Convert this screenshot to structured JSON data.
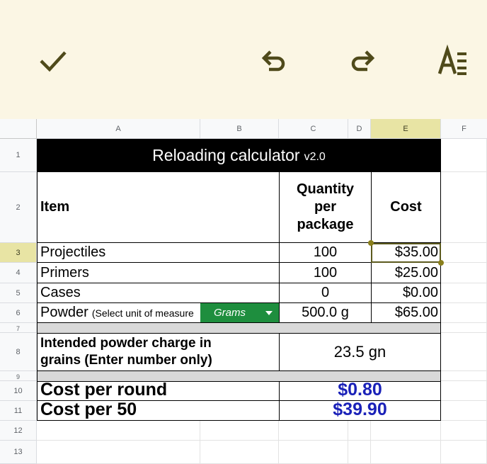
{
  "toolbar": {
    "confirm_icon": "check-icon",
    "undo_icon": "undo-icon",
    "redo_icon": "redo-icon",
    "format_icon": "text-format-icon"
  },
  "columns": [
    "A",
    "B",
    "C",
    "D",
    "E",
    "F"
  ],
  "rows": [
    "1",
    "2",
    "3",
    "4",
    "5",
    "6",
    "7",
    "8",
    "9",
    "10",
    "11",
    "12",
    "13"
  ],
  "selected": {
    "column": "E",
    "row": "3"
  },
  "sheet": {
    "title": "Reloading calculator",
    "version": "v2.0",
    "header_item": "Item",
    "header_quantity": "Quantity per package",
    "header_cost": "Cost",
    "items": [
      {
        "name": "Projectiles",
        "quantity": "100",
        "cost": "$35.00"
      },
      {
        "name": "Primers",
        "quantity": "100",
        "cost": "$25.00"
      },
      {
        "name": "Cases",
        "quantity": "0",
        "cost": "$0.00"
      },
      {
        "name": "Powder",
        "note": "(Select unit of measure",
        "unit": "Grams",
        "quantity": "500.0 g",
        "cost": "$65.00"
      }
    ],
    "charge_label": "Intended powder charge in grains (Enter number only)",
    "charge_value": "23.5 gn",
    "cost_per_round_label": "Cost per round",
    "cost_per_round_value": "$0.80",
    "cost_per_50_label": "Cost per 50",
    "cost_per_50_value": "$39.90"
  },
  "colors": {
    "toolbar_bg": "#fbf6e4",
    "icon": "#4f4a1a",
    "title_bg": "#000000",
    "dropdown_bg": "#1e8e3e",
    "total_value": "#1a21b8",
    "selection_border": "#5c5a1e"
  }
}
